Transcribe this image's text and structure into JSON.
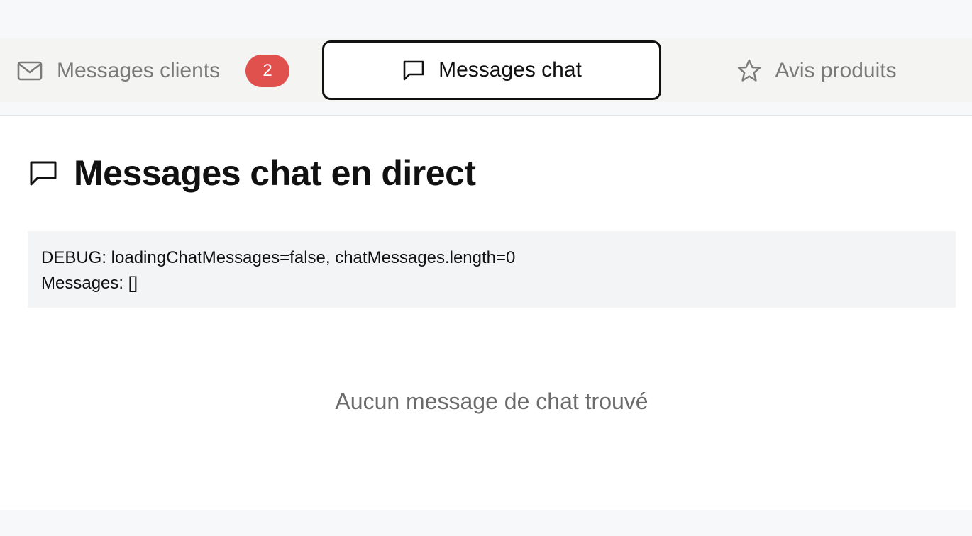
{
  "tabs": {
    "clients": {
      "label": "Messages clients",
      "icon": "mail-icon",
      "badge": "2",
      "badge_color": "#e0514d"
    },
    "chat": {
      "label": "Messages chat",
      "icon": "message-square-icon",
      "active": true
    },
    "reviews": {
      "label": "Avis produits",
      "icon": "star-icon"
    }
  },
  "main": {
    "title": "Messages chat en direct",
    "title_icon": "message-square-icon",
    "debug": {
      "line1": "DEBUG: loadingChatMessages=false, chatMessages.length=0",
      "line2": "Messages: []"
    },
    "empty_text": "Aucun message de chat trouvé"
  }
}
